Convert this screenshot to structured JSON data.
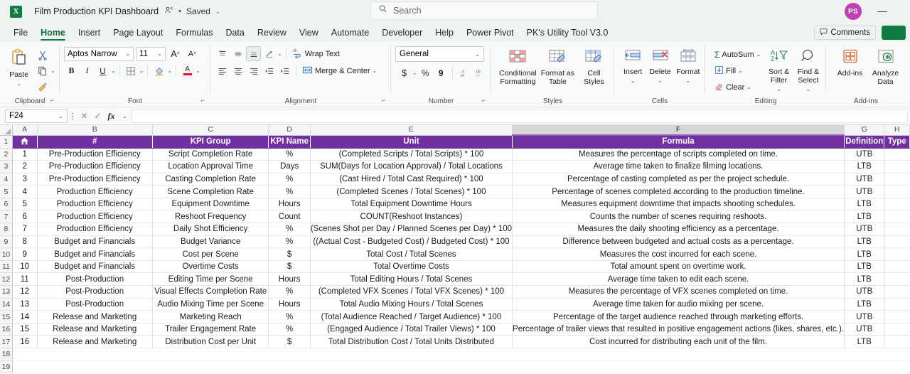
{
  "titlebar": {
    "app_icon": "excel-logo",
    "app_icon_letter": "X",
    "document_title": "Film Production KPI Dashboard",
    "people_icon": "people-share-icon",
    "separator_dot": "•",
    "save_status": "Saved",
    "status_caret": "⌄",
    "search_icon": "search-icon",
    "search_placeholder": "Search",
    "avatar_initials": "PS",
    "minimize_label": "—"
  },
  "tabs": [
    {
      "label": "File",
      "active": false
    },
    {
      "label": "Home",
      "active": true
    },
    {
      "label": "Insert",
      "active": false
    },
    {
      "label": "Page Layout",
      "active": false
    },
    {
      "label": "Formulas",
      "active": false
    },
    {
      "label": "Data",
      "active": false
    },
    {
      "label": "Review",
      "active": false
    },
    {
      "label": "View",
      "active": false
    },
    {
      "label": "Automate",
      "active": false
    },
    {
      "label": "Developer",
      "active": false
    },
    {
      "label": "Help",
      "active": false
    },
    {
      "label": "Power Pivot",
      "active": false
    },
    {
      "label": "PK's Utility Tool V3.0",
      "active": false
    }
  ],
  "comments_button": {
    "label": "Comments",
    "icon": "comment-icon"
  },
  "ribbon": {
    "clipboard": {
      "group_label": "Clipboard",
      "paste_label": "Paste",
      "paste_icon": "paste-icon",
      "cut_icon": "scissors-icon",
      "copy_icon": "copy-icon",
      "format_painter_icon": "format-painter-icon",
      "dialog_launcher": "⌐"
    },
    "font": {
      "group_label": "Font",
      "font_name": "Aptos Narrow",
      "font_size": "11",
      "grow_font_icon": "grow-font-icon",
      "shrink_font_icon": "shrink-font-icon",
      "bold": "B",
      "italic": "I",
      "underline": "U",
      "borders_icon": "borders-icon",
      "fill_color_icon": "fill-color-icon",
      "font_color_icon": "font-color-icon",
      "dialog_launcher": "⌐"
    },
    "alignment": {
      "group_label": "Alignment",
      "align_top_icon": "align-top-icon",
      "align_middle_icon": "align-middle-icon",
      "align_bottom_icon": "align-bottom-icon",
      "orientation_icon": "orientation-icon",
      "align_left_icon": "align-left-icon",
      "align_center_icon": "align-center-icon",
      "align_right_icon": "align-right-icon",
      "decrease_indent_icon": "decrease-indent-icon",
      "increase_indent_icon": "increase-indent-icon",
      "wrap_text_label": "Wrap Text",
      "wrap_text_icon": "wrap-text-icon",
      "merge_center_label": "Merge & Center",
      "merge_center_icon": "merge-cells-icon",
      "dialog_launcher": "⌐"
    },
    "number": {
      "group_label": "Number",
      "format_value": "General",
      "currency_icon": "$",
      "percent_icon": "%",
      "comma_icon": "9",
      "increase_decimal_icon": "increase-decimal-icon",
      "decrease_decimal_icon": "decrease-decimal-icon",
      "dialog_launcher": "⌐"
    },
    "styles": {
      "group_label": "Styles",
      "conditional_formatting": "Conditional Formatting",
      "conditional_formatting_icon": "conditional-formatting-icon",
      "format_as_table": "Format as Table",
      "format_as_table_icon": "format-as-table-icon",
      "cell_styles": "Cell Styles",
      "cell_styles_icon": "cell-styles-icon"
    },
    "cells": {
      "group_label": "Cells",
      "insert": "Insert",
      "insert_icon": "insert-cells-icon",
      "delete": "Delete",
      "delete_icon": "delete-cells-icon",
      "format": "Format",
      "format_icon": "format-cells-icon"
    },
    "editing": {
      "group_label": "Editing",
      "autosum": "AutoSum",
      "autosum_icon": "sigma-icon",
      "fill": "Fill",
      "fill_icon": "fill-down-icon",
      "clear": "Clear",
      "clear_icon": "eraser-icon",
      "sort_filter": "Sort & Filter",
      "sort_filter_icon": "sort-filter-icon",
      "find_select": "Find & Select",
      "find_select_icon": "magnifier-icon"
    },
    "addins": {
      "group_label": "Add-ins",
      "addins": "Add-ins",
      "addins_icon": "addins-grid-icon",
      "analyze_data": "Analyze Data",
      "analyze_data_icon": "analyze-data-icon"
    }
  },
  "formula_bar": {
    "name_box": "F24",
    "cancel_icon": "cancel-icon",
    "enter_icon": "check-icon",
    "fx_icon": "fx",
    "formula_value": ""
  },
  "sheet": {
    "column_headers": [
      "A",
      "B",
      "C",
      "D",
      "E",
      "F",
      "G",
      "H"
    ],
    "selected_column": "F",
    "row_headers": [
      "1",
      "2",
      "3",
      "4",
      "5",
      "6",
      "7",
      "8",
      "9",
      "10",
      "11",
      "12",
      "13",
      "14",
      "15",
      "16",
      "17",
      "18",
      "19"
    ],
    "header_row": {
      "home_icon": "home-icon",
      "cells": [
        "",
        "#",
        "KPI Group",
        "KPI Name",
        "Unit",
        "Formula",
        "Definition",
        "Type"
      ]
    },
    "header_fill": "#7030a0",
    "header_text_color": "#ffffff",
    "rows": [
      [
        "1",
        "Pre-Production Efficiency",
        "Script Completion Rate",
        "%",
        "(Completed Scripts / Total Scripts) * 100",
        "Measures the percentage of scripts completed on time.",
        "UTB"
      ],
      [
        "2",
        "Pre-Production Efficiency",
        "Location Approval Time",
        "Days",
        "SUM(Days for Location Approval) / Total Locations",
        "Average time taken to finalize filming locations.",
        "LTB"
      ],
      [
        "3",
        "Pre-Production Efficiency",
        "Casting Completion Rate",
        "%",
        "(Cast Hired / Total Cast Required) * 100",
        "Percentage of casting completed as per the project schedule.",
        "UTB"
      ],
      [
        "4",
        "Production Efficiency",
        "Scene Completion Rate",
        "%",
        "(Completed Scenes / Total Scenes) * 100",
        "Percentage of scenes completed according to the production timeline.",
        "UTB"
      ],
      [
        "5",
        "Production Efficiency",
        "Equipment Downtime",
        "Hours",
        "Total Equipment Downtime Hours",
        "Measures equipment downtime that impacts shooting schedules.",
        "LTB"
      ],
      [
        "6",
        "Production Efficiency",
        "Reshoot Frequency",
        "Count",
        "COUNT(Reshoot Instances)",
        "Counts the number of scenes requiring reshoots.",
        "LTB"
      ],
      [
        "7",
        "Production Efficiency",
        "Daily Shot Efficiency",
        "%",
        "(Scenes Shot per Day / Planned Scenes per Day) * 100",
        "Measures the daily shooting efficiency as a percentage.",
        "UTB"
      ],
      [
        "8",
        "Budget and Financials",
        "Budget Variance",
        "%",
        "((Actual Cost - Budgeted Cost) / Budgeted Cost) * 100",
        "Difference between budgeted and actual costs as a percentage.",
        "LTB"
      ],
      [
        "9",
        "Budget and Financials",
        "Cost per Scene",
        "$",
        "Total Cost / Total Scenes",
        "Measures the cost incurred for each scene.",
        "LTB"
      ],
      [
        "10",
        "Budget and Financials",
        "Overtime Costs",
        "$",
        "Total Overtime Costs",
        "Total amount spent on overtime work.",
        "LTB"
      ],
      [
        "11",
        "Post-Production",
        "Editing Time per Scene",
        "Hours",
        "Total Editing Hours / Total Scenes",
        "Average time taken to edit each scene.",
        "LTB"
      ],
      [
        "12",
        "Post-Production",
        "Visual Effects Completion Rate",
        "%",
        "(Completed VFX Scenes / Total VFX Scenes) * 100",
        "Measures the percentage of VFX scenes completed on time.",
        "UTB"
      ],
      [
        "13",
        "Post-Production",
        "Audio Mixing Time per Scene",
        "Hours",
        "Total Audio Mixing Hours / Total Scenes",
        "Average time taken for audio mixing per scene.",
        "LTB"
      ],
      [
        "14",
        "Release and Marketing",
        "Marketing Reach",
        "%",
        "(Total Audience Reached / Target Audience) * 100",
        "Percentage of the target audience reached through marketing efforts.",
        "UTB"
      ],
      [
        "15",
        "Release and Marketing",
        "Trailer Engagement Rate",
        "%",
        "(Engaged Audience / Total Trailer Views) * 100",
        "Percentage of trailer views that resulted in positive engagement actions (likes, shares, etc.).",
        "UTB"
      ],
      [
        "16",
        "Release and Marketing",
        "Distribution Cost per Unit",
        "$",
        "Total Distribution Cost / Total Units Distributed",
        "Cost incurred for distributing each unit of the film.",
        "LTB"
      ]
    ]
  }
}
